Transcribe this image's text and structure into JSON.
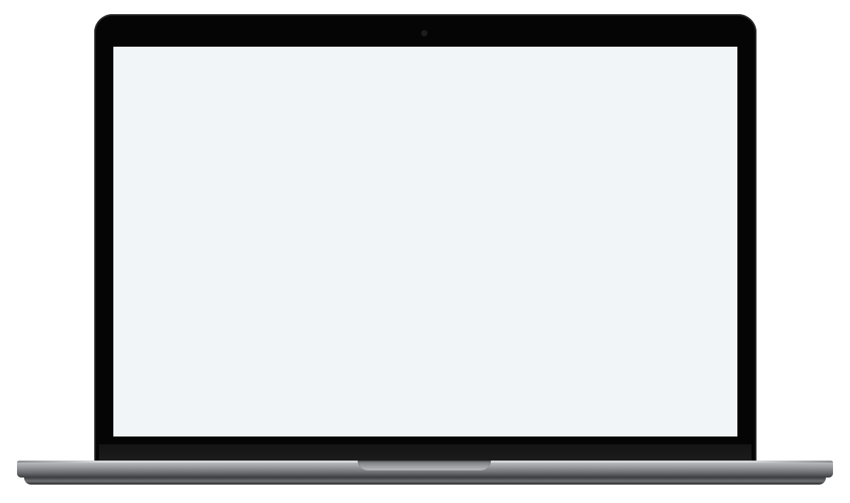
{
  "scene": {
    "device": "laptop",
    "colors": {
      "background": "#ffffff",
      "bezel": "#050505",
      "screen": "#f2f5f8",
      "chassis": "#9c9ea2"
    },
    "icons": [
      "camera-icon"
    ]
  }
}
